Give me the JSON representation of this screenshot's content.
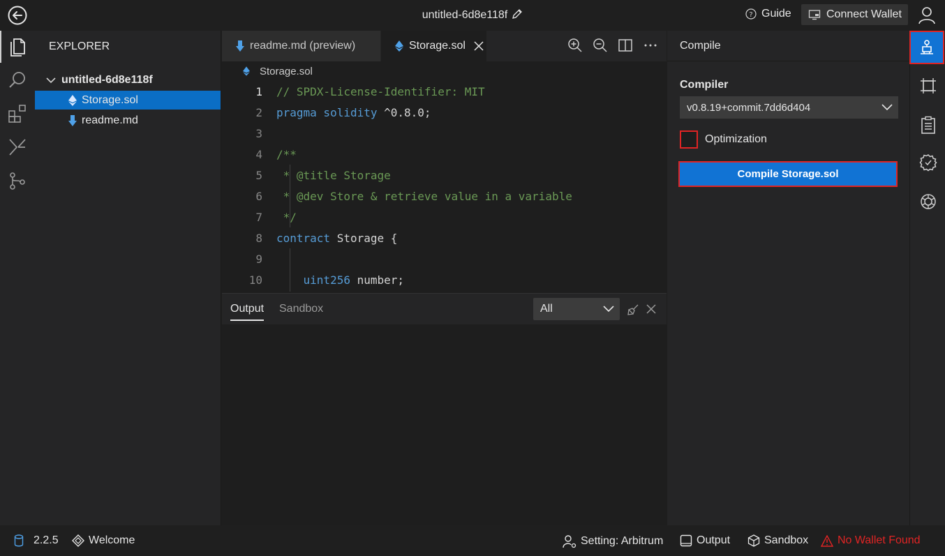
{
  "titlebar": {
    "project_name": "untitled-6d8e118f",
    "guide_label": "Guide",
    "connect_wallet_label": "Connect Wallet"
  },
  "explorer": {
    "title": "EXPLORER",
    "root": "untitled-6d8e118f",
    "files": [
      {
        "name": "Storage.sol",
        "icon": "ethereum-icon",
        "selected": true
      },
      {
        "name": "readme.md",
        "icon": "markdown-arrow-icon",
        "selected": false
      }
    ]
  },
  "editor": {
    "tabs": [
      {
        "label": "readme.md (preview)",
        "active": false
      },
      {
        "label": "Storage.sol",
        "active": true
      }
    ],
    "breadcrumb": "Storage.sol",
    "current_line": 1,
    "lines": [
      {
        "n": "1",
        "parts": [
          {
            "t": "// SPDX-License-Identifier: MIT",
            "c": "cm"
          }
        ]
      },
      {
        "n": "2",
        "parts": [
          {
            "t": "pragma solidity ",
            "c": "kw"
          },
          {
            "t": "^0.8.0;",
            "c": "tx"
          }
        ]
      },
      {
        "n": "3",
        "parts": []
      },
      {
        "n": "4",
        "parts": [
          {
            "t": "/**",
            "c": "cm"
          }
        ]
      },
      {
        "n": "5",
        "parts": [
          {
            "t": " * @title Storage",
            "c": "cm"
          }
        ]
      },
      {
        "n": "6",
        "parts": [
          {
            "t": " * @dev Store & retrieve value in a variable",
            "c": "cm"
          }
        ]
      },
      {
        "n": "7",
        "parts": [
          {
            "t": " */",
            "c": "cm"
          }
        ]
      },
      {
        "n": "8",
        "parts": [
          {
            "t": "contract ",
            "c": "kw"
          },
          {
            "t": "Storage {",
            "c": "tx"
          }
        ]
      },
      {
        "n": "9",
        "parts": []
      },
      {
        "n": "10",
        "parts": [
          {
            "t": "    uint256 ",
            "c": "kw"
          },
          {
            "t": "number;",
            "c": "tx"
          }
        ]
      }
    ]
  },
  "panel": {
    "tabs": [
      {
        "label": "Output",
        "active": true
      },
      {
        "label": "Sandbox",
        "active": false
      }
    ],
    "filter_value": "All"
  },
  "compile": {
    "title": "Compile",
    "compiler_label": "Compiler",
    "compiler_version": "v0.8.19+commit.7dd6d404",
    "optimization_label": "Optimization",
    "optimization_checked": false,
    "compile_button": "Compile Storage.sol"
  },
  "statusbar": {
    "version": "2.2.5",
    "welcome": "Welcome",
    "setting": "Setting: Arbitrum",
    "output": "Output",
    "sandbox": "Sandbox",
    "wallet_status": "No Wallet Found"
  },
  "colors": {
    "accent": "#1173d4",
    "highlight_border": "#e02424",
    "warning": "#e02424",
    "comment": "#6a9955",
    "keyword": "#569cd6"
  }
}
